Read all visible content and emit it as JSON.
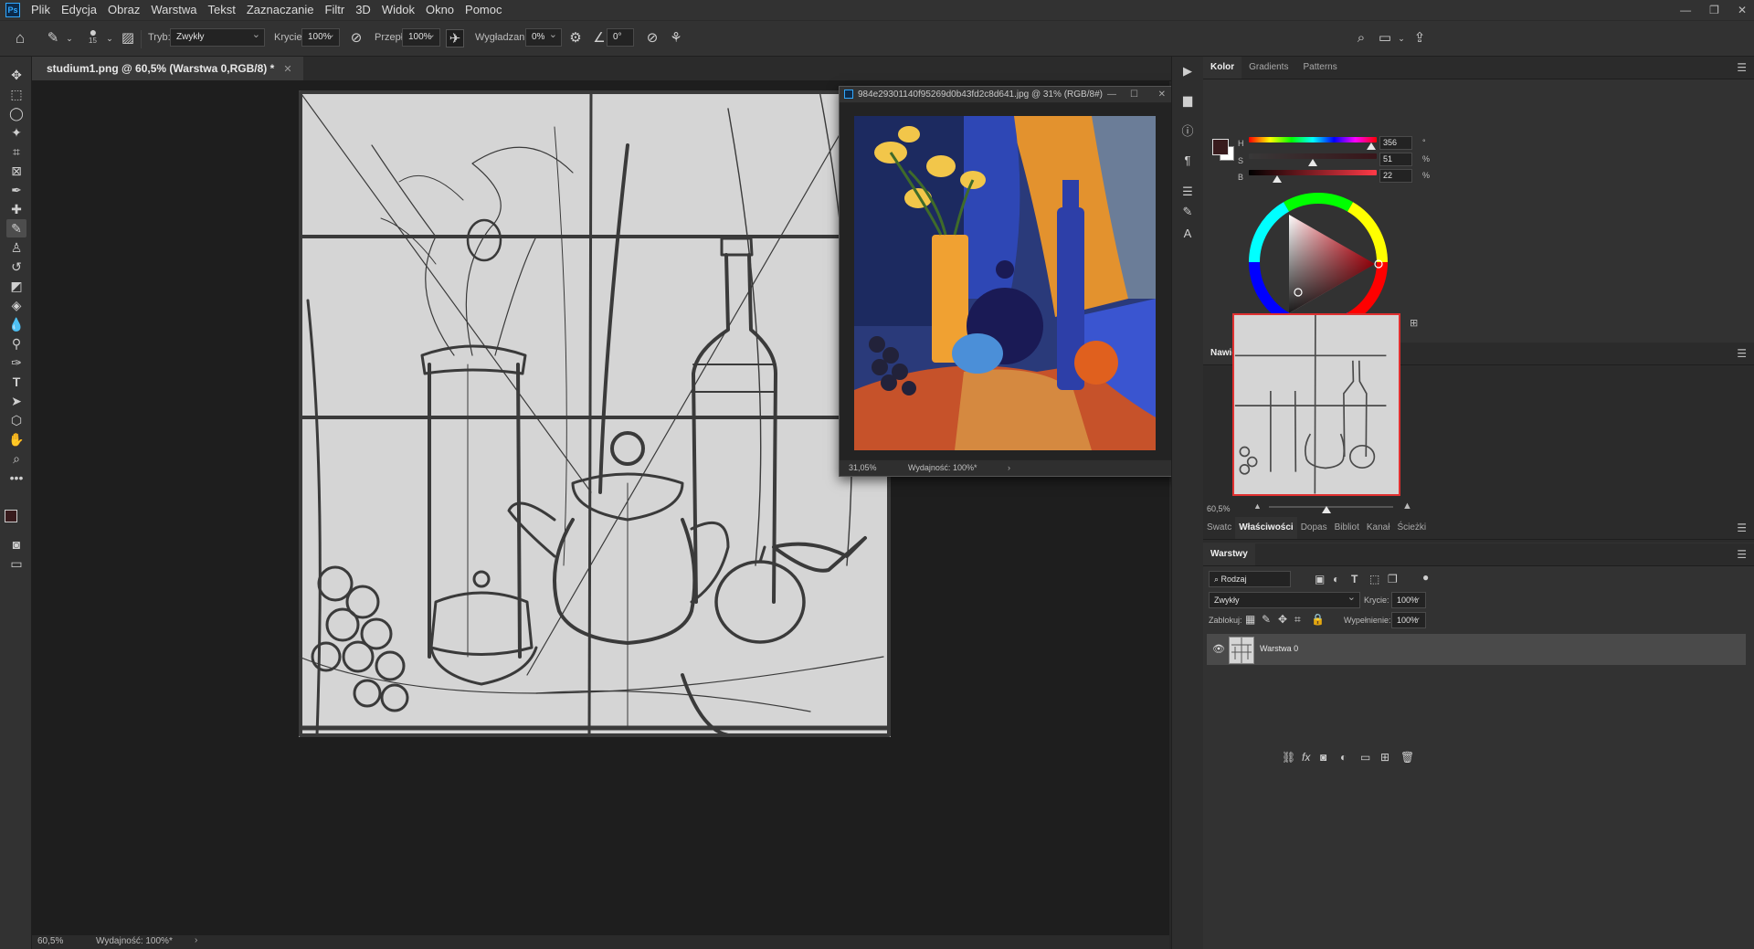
{
  "app": {
    "logo": "Ps"
  },
  "menu": [
    "Plik",
    "Edycja",
    "Obraz",
    "Warstwa",
    "Tekst",
    "Zaznaczanie",
    "Filtr",
    "3D",
    "Widok",
    "Okno",
    "Pomoc"
  ],
  "options": {
    "brush_size": "15",
    "mode_label": "Tryb:",
    "mode_value": "Zwykły",
    "opacity_label": "Krycie:",
    "opacity_value": "100%",
    "flow_label": "Przepł:",
    "flow_value": "100%",
    "smoothing_label": "Wygładzanie:",
    "smoothing_value": "0%",
    "angle_value": "0°"
  },
  "document": {
    "tab_title": "studium1.png @ 60,5% (Warstwa 0,RGB/8) *",
    "zoom": "60,5%",
    "performance": "Wydajność: 100%*"
  },
  "float_window": {
    "title": "984e29301140f95269d0b43fd2c8d641.jpg @ 31% (RGB/8#)",
    "zoom": "31,05%",
    "performance": "Wydajność: 100%*"
  },
  "color_panel": {
    "tabs": [
      "Kolor",
      "Gradients",
      "Patterns"
    ],
    "h_label": "H",
    "h_value": "356",
    "h_unit": "°",
    "s_label": "S",
    "s_value": "51",
    "s_unit": "%",
    "b_label": "B",
    "b_value": "22",
    "b_unit": "%",
    "foreground_color": "#381b1d",
    "background_color": "#ffffff"
  },
  "navigator": {
    "title": "Nawigator",
    "zoom": "60,5%"
  },
  "props_tabs": [
    "Swatc",
    "Właściwości",
    "Dopas",
    "Bibliot",
    "Kanał",
    "Ścieżki"
  ],
  "layers": {
    "title": "Warstwy",
    "filter_label": "Rodzaj",
    "blend_mode": "Zwykły",
    "opacity_label": "Krycie:",
    "opacity_value": "100%",
    "lock_label": "Zablokuj:",
    "fill_label": "Wypełnienie:",
    "fill_value": "100%",
    "items": [
      {
        "name": "Warstwa 0"
      }
    ]
  }
}
